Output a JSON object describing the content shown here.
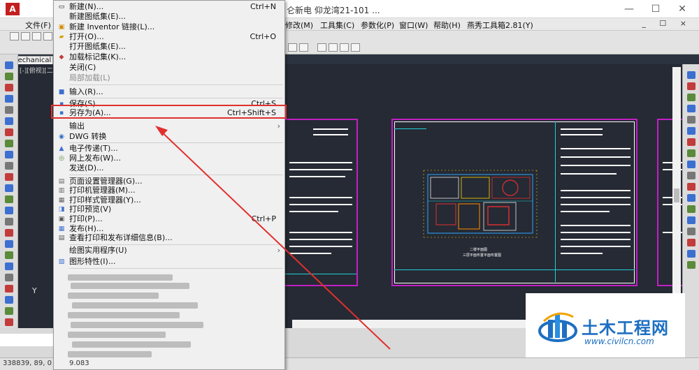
{
  "titlebar": {
    "title": "仑新电  仰龙湾21-101  ...",
    "logo_letter": "A",
    "minimize": "—",
    "maximize": "☐",
    "close": "✕"
  },
  "menubar": {
    "items": [
      {
        "label": "文件(F)"
      },
      {
        "label": "修改(M)"
      },
      {
        "label": "工具集(C)"
      },
      {
        "label": "参数化(P)"
      },
      {
        "label": "窗口(W)"
      },
      {
        "label": "帮助(H)"
      },
      {
        "label": "燕秀工具箱2.81(Y)"
      }
    ],
    "doc_controls": "_ ☐ ×"
  },
  "workspace": {
    "selected": "Mechanical 移"
  },
  "app_menu": {
    "items": [
      {
        "label": "新建(N)...",
        "shortcut": "Ctrl+N",
        "icon": "new-file-icon"
      },
      {
        "label": "新建图纸集(E)...",
        "shortcut": "",
        "icon": ""
      },
      {
        "label": "新建 Inventor 链接(L)...",
        "shortcut": "",
        "icon": "inventor-link-icon"
      },
      {
        "label": "打开(O)...",
        "shortcut": "Ctrl+O",
        "icon": "open-folder-icon"
      },
      {
        "label": "打开图纸集(E)...",
        "shortcut": "",
        "icon": ""
      },
      {
        "label": "加载标记集(K)...",
        "shortcut": "",
        "icon": "markup-icon"
      },
      {
        "label": "关闭(C)",
        "shortcut": "",
        "icon": ""
      },
      {
        "label": "局部加载(L)",
        "shortcut": "",
        "icon": "",
        "disabled": true
      },
      {
        "label": "输入(R)...",
        "shortcut": "",
        "icon": "import-icon"
      },
      {
        "label": "保存(S)",
        "shortcut": "Ctrl+S",
        "icon": "save-icon"
      },
      {
        "label": "另存为(A)...",
        "shortcut": "Ctrl+Shift+S",
        "icon": "save-as-icon"
      },
      {
        "label": "输出",
        "shortcut": "",
        "icon": "",
        "submenu": true
      },
      {
        "label": "DWG 转换",
        "shortcut": "",
        "icon": "dwg-convert-icon"
      },
      {
        "label": "电子传递(T)...",
        "shortcut": "",
        "icon": "etransmit-icon"
      },
      {
        "label": "网上发布(W)...",
        "shortcut": "",
        "icon": "web-publish-icon"
      },
      {
        "label": "发送(D)...",
        "shortcut": "",
        "icon": ""
      },
      {
        "label": "页面设置管理器(G)...",
        "shortcut": "",
        "icon": "page-setup-icon"
      },
      {
        "label": "打印机管理器(M)...",
        "shortcut": "",
        "icon": "plotter-manager-icon"
      },
      {
        "label": "打印样式管理器(Y)...",
        "shortcut": "",
        "icon": "plot-style-icon"
      },
      {
        "label": "打印预览(V)",
        "shortcut": "",
        "icon": "print-preview-icon"
      },
      {
        "label": "打印(P)...",
        "shortcut": "Ctrl+P",
        "icon": "print-icon"
      },
      {
        "label": "发布(H)...",
        "shortcut": "",
        "icon": "publish-icon"
      },
      {
        "label": "查看打印和发布详细信息(B)...",
        "shortcut": "",
        "icon": "plot-details-icon"
      },
      {
        "label": "绘图实用程序(U)",
        "shortcut": "",
        "icon": "",
        "submenu": true
      },
      {
        "label": "图形特性(I)...",
        "shortcut": "",
        "icon": "drawing-properties-icon"
      }
    ],
    "submenu_arrow": "›"
  },
  "canvas": {
    "ucs_axis_label": "Y",
    "model_tab": "[-][俯视][二维线框]",
    "sheet_captions": [
      "二楼平面图",
      "三层平面布置平面布置图"
    ]
  },
  "status": {
    "coords": "338839, 89, 0",
    "cmd_text": "9.083"
  },
  "watermark": {
    "title": "土木工程网",
    "url": "www.civilcn.com"
  },
  "colors": {
    "menu_bg": "#f0f0f0",
    "highlight": "#e0302e",
    "canvas_bg": "#252a34",
    "sheet_border": "#c21fc4",
    "brand_blue": "#1d6fc2"
  }
}
